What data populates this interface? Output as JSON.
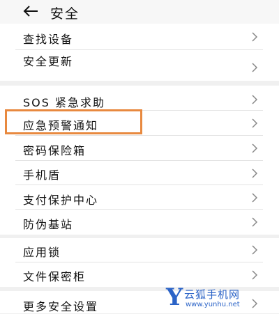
{
  "header": {
    "title": "安全"
  },
  "groups": [
    {
      "items": [
        {
          "label": "查找设备"
        },
        {
          "label": "安全更新"
        }
      ]
    },
    {
      "items": [
        {
          "label": "SOS 紧急求助"
        },
        {
          "label": "应急预警通知"
        },
        {
          "label": "密码保险箱"
        },
        {
          "label": "手机盾"
        },
        {
          "label": "支付保护中心"
        },
        {
          "label": "防伪基站"
        }
      ]
    },
    {
      "items": [
        {
          "label": "应用锁"
        },
        {
          "label": "文件保密柜"
        }
      ]
    },
    {
      "items": [
        {
          "label": "更多安全设置"
        }
      ]
    }
  ],
  "watermark": {
    "logo": "Y",
    "name": "云狐手机网",
    "url": "www.yunhu.net"
  },
  "colors": {
    "highlight": "#e8893f",
    "watermark": "#2b63c7"
  },
  "icons": {
    "back": "arrow-left-icon",
    "chevron": "chevron-right-icon"
  }
}
